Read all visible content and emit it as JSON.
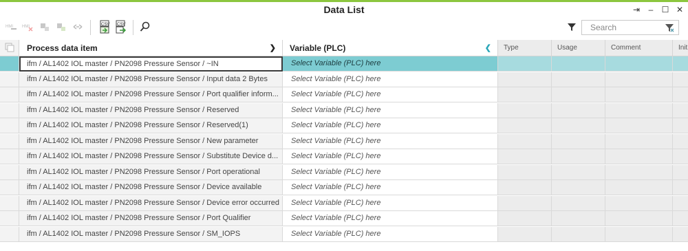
{
  "window": {
    "title": "Data List",
    "controls": [
      "⇥",
      "–",
      "☐",
      "✕"
    ]
  },
  "toolbar": {
    "icons": [
      "hmi-link-icon",
      "hmi-unlink-icon",
      "add-tag-icon",
      "remove-tag-icon",
      "link-icon",
      "import-csv-icon",
      "export-csv-icon",
      "search-icon"
    ],
    "search_placeholder": "Search",
    "csv_label": "CSV"
  },
  "columns": {
    "process_data_item": "Process data item",
    "variable_plc": "Variable (PLC)",
    "type": "Type",
    "usage": "Usage",
    "comment": "Comment",
    "initial": "Init"
  },
  "rows": [
    {
      "item": "ifm / AL1402 IOL master / PN2098 Pressure Sensor / ~IN",
      "variable": "Select Variable (PLC) here"
    },
    {
      "item": "ifm / AL1402 IOL master / PN2098 Pressure Sensor / Input data 2 Bytes",
      "variable": "Select Variable (PLC) here"
    },
    {
      "item": "ifm / AL1402 IOL master / PN2098 Pressure Sensor / Port qualifier inform...",
      "variable": "Select Variable (PLC) here"
    },
    {
      "item": "ifm / AL1402 IOL master / PN2098 Pressure Sensor / Reserved",
      "variable": "Select Variable (PLC) here"
    },
    {
      "item": "ifm / AL1402 IOL master / PN2098 Pressure Sensor / Reserved(1)",
      "variable": "Select Variable (PLC) here"
    },
    {
      "item": "ifm / AL1402 IOL master / PN2098 Pressure Sensor / New parameter",
      "variable": "Select Variable (PLC) here"
    },
    {
      "item": "ifm / AL1402 IOL master / PN2098 Pressure Sensor / Substitute Device d...",
      "variable": "Select Variable (PLC) here"
    },
    {
      "item": "ifm / AL1402 IOL master / PN2098 Pressure Sensor / Port operational",
      "variable": "Select Variable (PLC) here"
    },
    {
      "item": "ifm / AL1402 IOL master / PN2098 Pressure Sensor / Device available",
      "variable": "Select Variable (PLC) here"
    },
    {
      "item": "ifm / AL1402 IOL master / PN2098 Pressure Sensor / Device error occurred",
      "variable": "Select Variable (PLC) here"
    },
    {
      "item": "ifm / AL1402 IOL master / PN2098 Pressure Sensor / Port Qualifier",
      "variable": "Select Variable (PLC) here"
    },
    {
      "item": "ifm / AL1402 IOL master / PN2098 Pressure Sensor / SM_IOPS",
      "variable": "Select Variable (PLC) here"
    }
  ],
  "colors": {
    "accent": "#8cc63f",
    "selection": "#7dccd2",
    "selection_light": "#a7dbdf"
  }
}
